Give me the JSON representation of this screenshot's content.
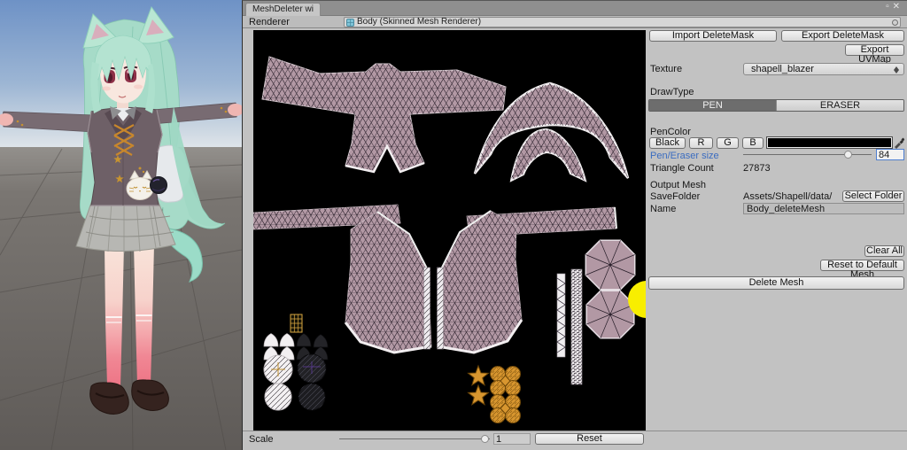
{
  "window": {
    "tab_title": "MeshDeleter wi",
    "controls": {
      "maximize": "▫",
      "close": "✕"
    },
    "renderer_label": "Renderer",
    "renderer_value": "Body (Skinned Mesh Renderer)"
  },
  "panel": {
    "import_deletemask": "Import DeleteMask",
    "export_deletemask": "Export DeleteMask",
    "export_uvmap": "Export UVMap",
    "texture_label": "Texture",
    "texture_value": "shapell_blazer",
    "drawtype_label": "DrawType",
    "pen_label": "PEN",
    "eraser_label": "ERASER",
    "pencolor_label": "PenColor",
    "color_buttons": [
      "Black",
      "R",
      "G",
      "B"
    ],
    "size_label": "Pen/Eraser size",
    "size_value": "84",
    "triangle_count_label": "Triangle Count",
    "triangle_count_value": "27873",
    "output_mesh_label": "Output Mesh",
    "savefolder_label": "SaveFolder",
    "savefolder_value": "Assets/Shapell/data/",
    "select_folder_label": "Select Folder",
    "name_label": "Name",
    "name_value": "Body_deleteMesh",
    "clear_all_label": "Clear All",
    "reset_default_label": "Reset to Default Mesh",
    "delete_mesh_label": "Delete Mesh"
  },
  "footer": {
    "scale_label": "Scale",
    "scale_value": "1",
    "reset_label": "Reset"
  },
  "colors": {
    "accent_blue": "#3a6cc0",
    "uv_mauve": "#b298a4",
    "gold": "#d8962f",
    "cursor_yellow": "#f8ee00",
    "pen_swatch": "#000000"
  }
}
